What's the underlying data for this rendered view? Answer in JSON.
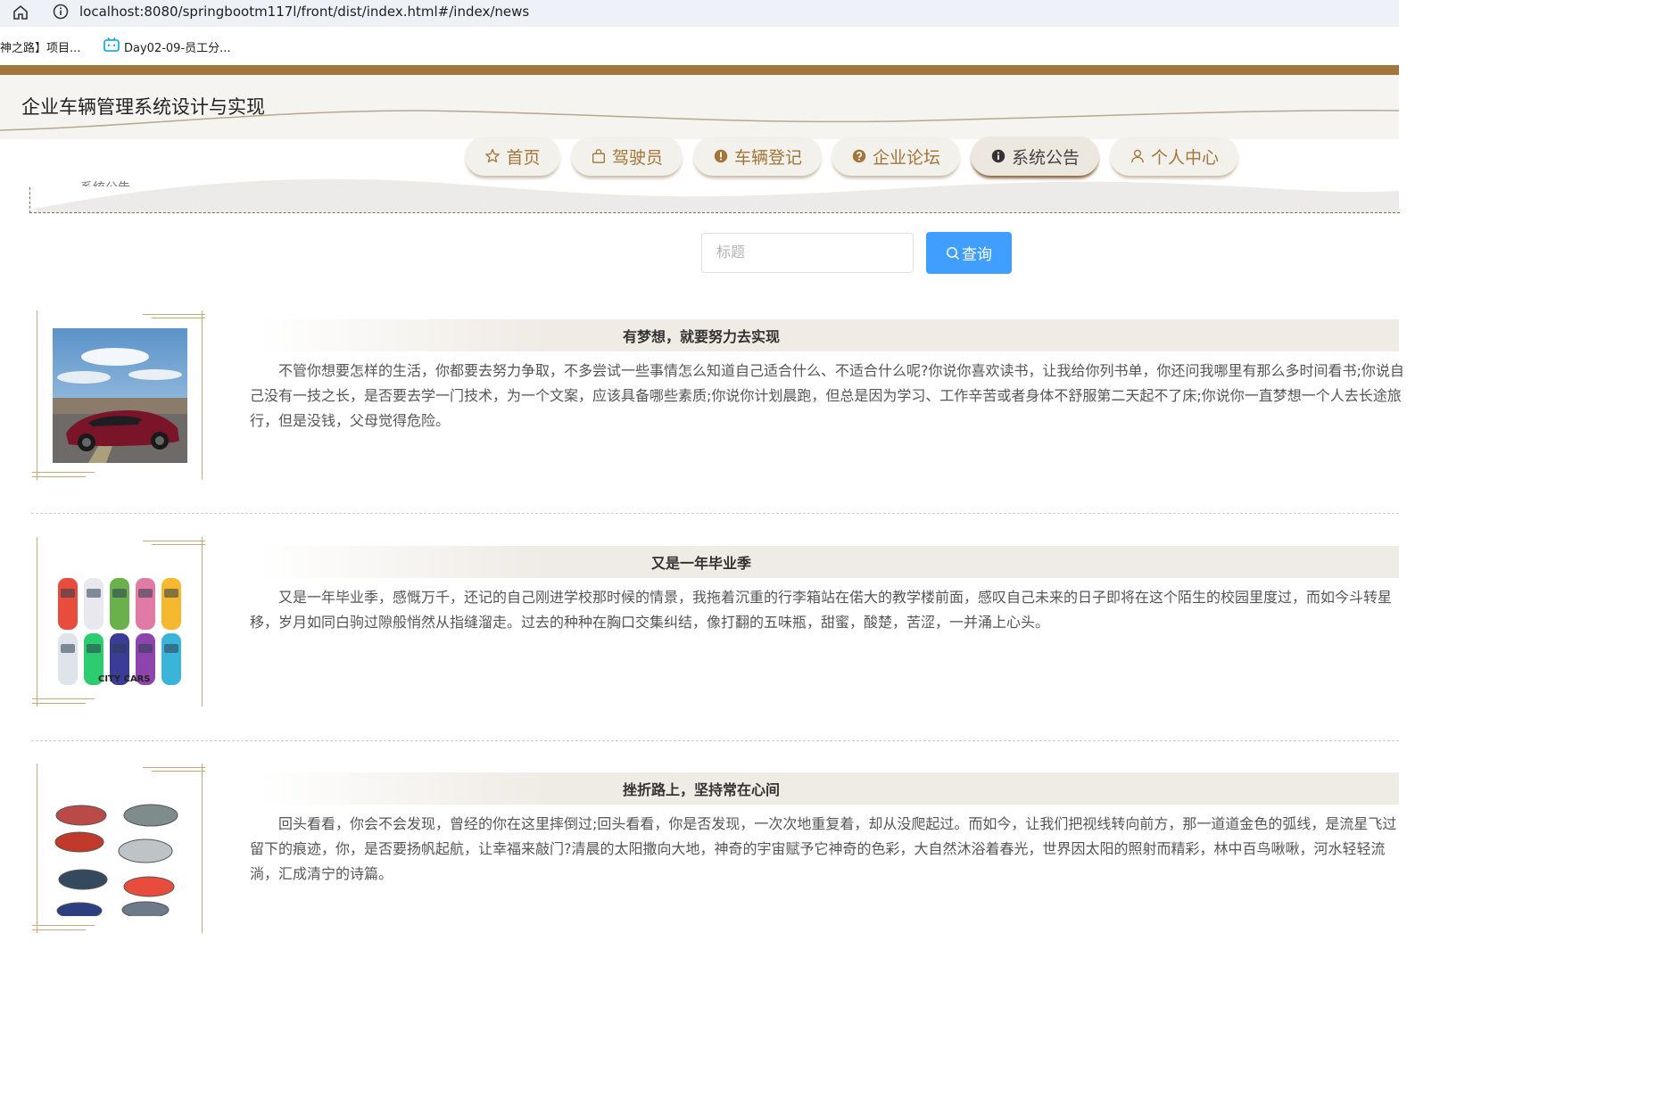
{
  "browser": {
    "url": "localhost:8080/springbootm117l/front/dist/index.html#/index/news",
    "bookmarks": [
      {
        "label": "神之路】项目..."
      },
      {
        "label": "Day02-09-员工分..."
      }
    ]
  },
  "site": {
    "title": "企业车辆管理系统设计与实现",
    "breadcrumb": "系统公告"
  },
  "nav": {
    "items": [
      {
        "label": "首页",
        "icon": "star-icon"
      },
      {
        "label": "驾驶员",
        "icon": "bag-icon"
      },
      {
        "label": "车辆登记",
        "icon": "exclamation-circle-icon"
      },
      {
        "label": "企业论坛",
        "icon": "question-circle-icon"
      },
      {
        "label": "系统公告",
        "icon": "info-circle-icon",
        "active": true
      },
      {
        "label": "个人中心",
        "icon": "user-icon"
      }
    ]
  },
  "search": {
    "placeholder": "标题",
    "value": "",
    "button_label": "查询"
  },
  "news": [
    {
      "title": "有梦想，就要努力去实现",
      "body": "不管你想要怎样的生活，你都要去努力争取，不多尝试一些事情怎么知道自己适合什么、不适合什么呢?你说你喜欢读书，让我给你列书单，你还问我哪里有那么多时间看书;你说自己没有一技之长，是否要去学一门技术，为一个文案，应该具备哪些素质;你说你计划晨跑，但总是因为学习、工作辛苦或者身体不舒服第二天起不了床;你说你一直梦想一个人去长途旅行，但是没钱，父母觉得危险。",
      "image": "red-sports-car"
    },
    {
      "title": "又是一年毕业季",
      "body": "又是一年毕业季，感慨万千，还记的自己刚进学校那时候的情景，我拖着沉重的行李箱站在偌大的教学楼前面，感叹自己未来的日子即将在这个陌生的校园里度过，而如今斗转星移，岁月如同白驹过隙般悄然从指缝溜走。过去的种种在胸口交集纠结，像打翻的五味瓶，甜蜜，酸楚，苦涩，一并涌上心头。",
      "image": "city-cars",
      "image_caption": "CITY CARS"
    },
    {
      "title": "挫折路上，坚持常在心间",
      "body": "回头看看，你会不会发现，曾经的你在这里摔倒过;回头看看，你是否发现，一次次地重复着，却从没爬起过。而如今，让我们把视线转向前方，那一道道金色的弧线，是流星飞过留下的痕迹，你，是否要扬帆起航，让幸福来敲门?清晨的太阳撒向大地，神奇的宇宙赋予它神奇的色彩，大自然沐浴着春光，世界因太阳的照射而精彩，林中百鸟啾啾，河水轻轻流淌，汇成清宁的诗篇。",
      "image": "car-cutaways"
    }
  ],
  "colors": {
    "brand_brown": "#a2753a",
    "search_button": "#409eff"
  }
}
